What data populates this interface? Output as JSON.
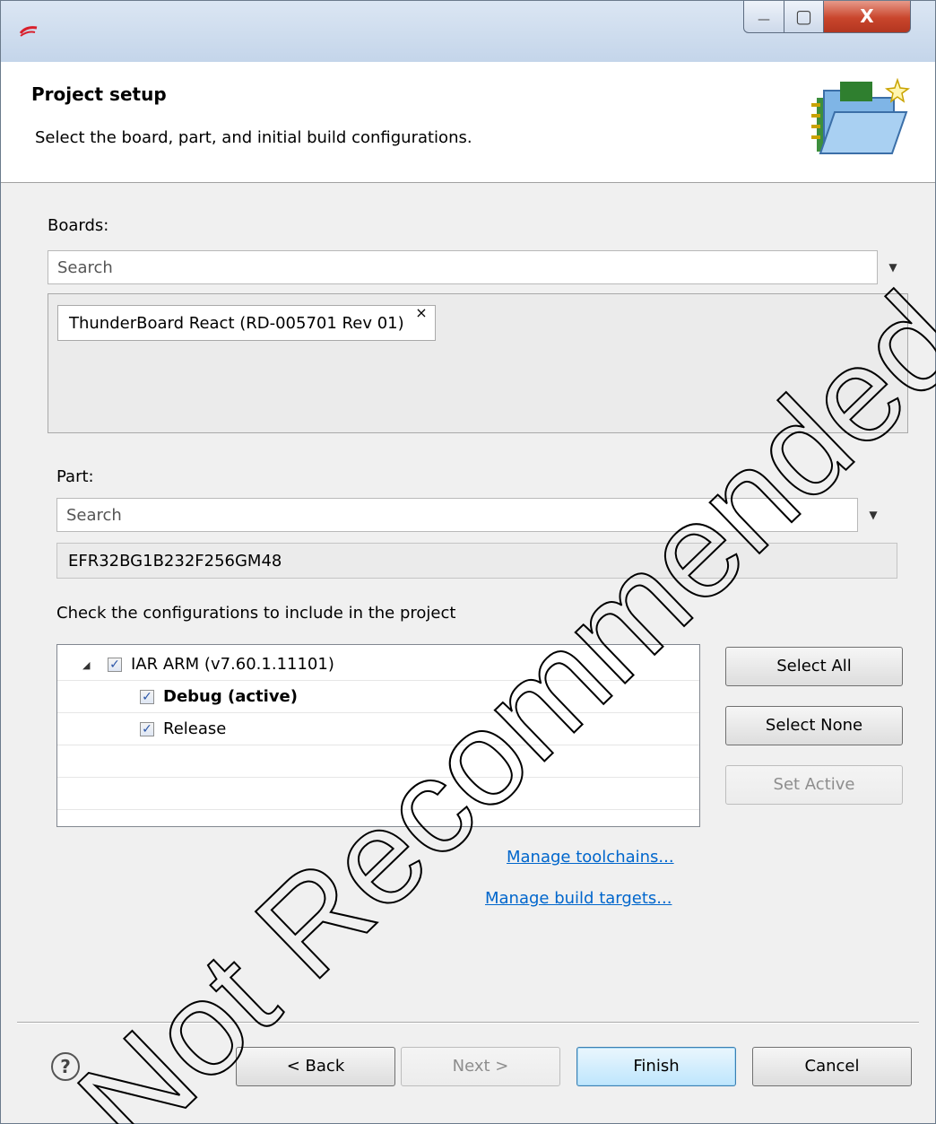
{
  "window": {
    "title_buttons": {
      "minimize": "—",
      "maximize": "▢",
      "close": "X"
    }
  },
  "header": {
    "title": "Project setup",
    "subtitle": "Select the board, part, and initial build configurations."
  },
  "boards": {
    "label": "Boards:",
    "search_placeholder": "Search",
    "selected": [
      {
        "label": "ThunderBoard React (RD-005701 Rev 01)",
        "remove": "×"
      }
    ]
  },
  "part": {
    "label": "Part:",
    "search_placeholder": "Search",
    "value": "EFR32BG1B232F256GM48"
  },
  "configurations": {
    "label": "Check the configurations to include in the project",
    "toolchain": {
      "label": "IAR ARM (v7.60.1.11101)",
      "checked": true,
      "expanded": true
    },
    "items": [
      {
        "label": "Debug (active)",
        "checked": true,
        "active": true
      },
      {
        "label": "Release",
        "checked": true,
        "active": false
      }
    ],
    "buttons": {
      "select_all": "Select All",
      "select_none": "Select None",
      "set_active": "Set Active"
    },
    "links": {
      "manage_toolchains": "Manage toolchains...",
      "manage_build_targets": "Manage build targets..."
    }
  },
  "footer": {
    "help": "?",
    "back": "< Back",
    "next": "Next >",
    "finish": "Finish",
    "cancel": "Cancel"
  },
  "watermark": {
    "text": "Not Recommended for New Designs",
    "color": "#000000"
  },
  "colors": {
    "link": "#0066cc",
    "close_button": "#c9452c",
    "checkbox_check": "#2b55a8"
  }
}
